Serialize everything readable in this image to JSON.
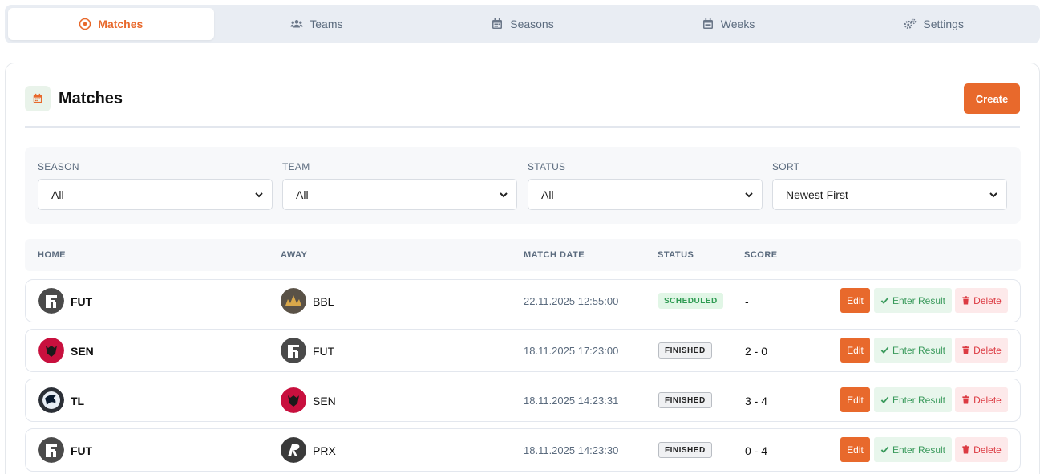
{
  "tabs": [
    {
      "label": "Matches",
      "icon": "futbol-icon",
      "active": true
    },
    {
      "label": "Teams",
      "icon": "users-icon"
    },
    {
      "label": "Seasons",
      "icon": "calendar-icon"
    },
    {
      "label": "Weeks",
      "icon": "calendar-week-icon"
    },
    {
      "label": "Settings",
      "icon": "cogs-icon"
    }
  ],
  "header": {
    "title": "Matches",
    "create_label": "Create"
  },
  "filters": [
    {
      "label": "SEASON",
      "value": "All"
    },
    {
      "label": "TEAM",
      "value": "All"
    },
    {
      "label": "STATUS",
      "value": "All"
    },
    {
      "label": "SORT",
      "value": "Newest First"
    }
  ],
  "table": {
    "headers": {
      "home": "HOME",
      "away": "AWAY",
      "date": "MATCH DATE",
      "status": "STATUS",
      "score": "SCORE"
    },
    "actions": {
      "edit": "Edit",
      "enter": "Enter Result",
      "delete": "Delete"
    },
    "rows": [
      {
        "home": "FUT",
        "away": "BBL",
        "date": "22.11.2025 12:55:00",
        "status": "SCHEDULED",
        "score": "-"
      },
      {
        "home": "SEN",
        "away": "FUT",
        "date": "18.11.2025 17:23:00",
        "status": "FINISHED",
        "score": "2 - 0"
      },
      {
        "home": "TL",
        "away": "SEN",
        "date": "18.11.2025 14:23:31",
        "status": "FINISHED",
        "score": "3 - 4"
      },
      {
        "home": "FUT",
        "away": "PRX",
        "date": "18.11.2025 14:23:30",
        "status": "FINISHED",
        "score": "0 - 4"
      }
    ]
  },
  "colors": {
    "accent": "#e8692c",
    "success": "#2e9b52",
    "danger": "#dc3a42",
    "muted": "#5b6b7e"
  }
}
